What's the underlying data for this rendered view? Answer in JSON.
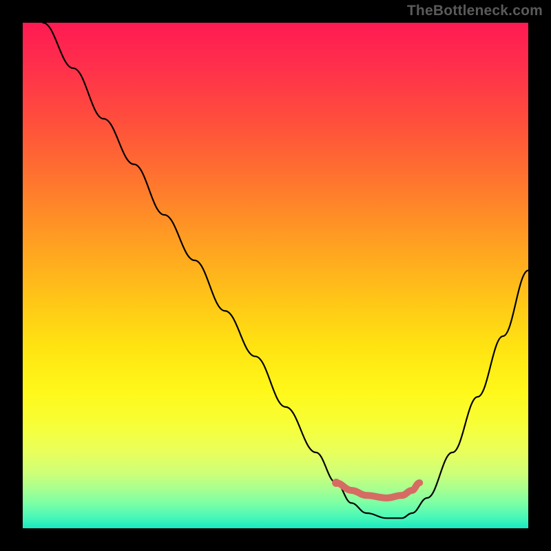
{
  "attribution": "TheBottleneck.com",
  "chart_data": {
    "type": "line",
    "title": "",
    "xlabel": "",
    "ylabel": "",
    "xlim": [
      0,
      100
    ],
    "ylim": [
      0,
      100
    ],
    "series": [
      {
        "name": "bottleneck-curve",
        "color": "#000000",
        "x": [
          4,
          10,
          16,
          22,
          28,
          34,
          40,
          46,
          52,
          58,
          62,
          65,
          68,
          72,
          75,
          77,
          80,
          85,
          90,
          95,
          100
        ],
        "y": [
          100,
          91,
          81,
          72,
          62,
          53,
          43,
          34,
          24,
          15,
          9,
          5,
          3,
          2,
          2,
          3,
          6,
          15,
          26,
          38,
          51
        ]
      }
    ],
    "markers": [
      {
        "name": "optimal-point",
        "x": 62,
        "y": 9,
        "color": "#d66b63",
        "size": 8
      }
    ],
    "segments": [
      {
        "name": "optimal-range",
        "color": "#d66b63",
        "width": 10,
        "points": [
          {
            "x": 62,
            "y": 9
          },
          {
            "x": 65,
            "y": 7.5
          },
          {
            "x": 68,
            "y": 6.5
          },
          {
            "x": 72,
            "y": 6
          },
          {
            "x": 75,
            "y": 6.5
          },
          {
            "x": 77,
            "y": 7.5
          },
          {
            "x": 78.5,
            "y": 9
          }
        ]
      }
    ],
    "gradient": {
      "top": "#ff1a52",
      "mid": "#ffe312",
      "bottom": "#18e7c1"
    }
  }
}
